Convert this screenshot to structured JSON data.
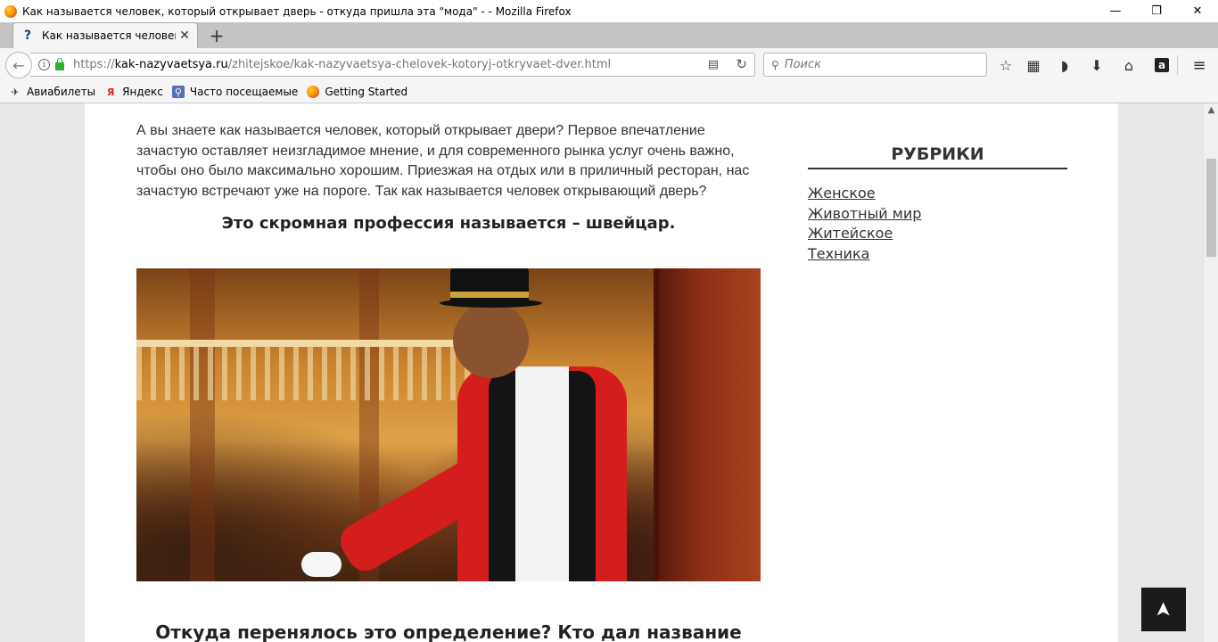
{
  "window": {
    "title": "Как называется человек, который открывает дверь - откуда пришла эта \"мода\" - - Mozilla Firefox",
    "minimize": "—",
    "restore": "❐",
    "close": "✕"
  },
  "tab": {
    "favicon": "?",
    "title": "Как называется человек, ко",
    "close": "✕",
    "new_tab": "+"
  },
  "navbar": {
    "back": "←",
    "info": "i",
    "url_proto": "https://",
    "url_host": "kak-nazyvaetsya.ru",
    "url_path": "/zhitejskoe/kak-nazyvaetsya-chelovek-kotoryj-otkryvaet-dver.html",
    "reader": "▤",
    "reload": "↻",
    "search_icon": "⚲",
    "search_placeholder": "Поиск",
    "icons": {
      "star": "☆",
      "library": "▦",
      "pocket": "◗",
      "download": "⬇",
      "home": "⌂",
      "amazon": "a",
      "menu": "≡"
    }
  },
  "bookmarks": [
    {
      "label": "Авиабилеты",
      "icon": "✈"
    },
    {
      "label": "Яндекс",
      "icon": "Я"
    },
    {
      "label": "Часто посещаемые",
      "icon": "⚲"
    },
    {
      "label": "Getting Started",
      "icon": ""
    }
  ],
  "article": {
    "intro": "А вы знаете как называется человек, который открывает двери? Первое впечатление зачастую оставляет неизгладимое мнение, и для современного рынка услуг очень важно, чтобы оно было максимально хорошим. Приезжая на отдых или в приличный ресторан, нас зачастую встречают уже на пороге. Так как называется человек открывающий дверь?",
    "subhead": "Это скромная профессия называется – швейцар.",
    "subhead2": "Откуда перенялось это определение? Кто дал название тому, как называется человек, который открывает дверь?"
  },
  "sidebar": {
    "title": "РУБРИКИ",
    "links": [
      "Женское",
      "Животный мир",
      "Житейское",
      "Техника"
    ]
  },
  "back_to_top": "➤",
  "scrollbar": {
    "up": "▲"
  }
}
